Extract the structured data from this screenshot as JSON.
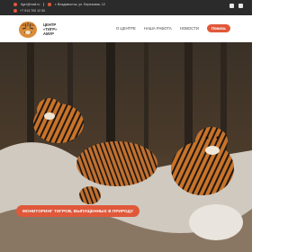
{
  "topbar": {
    "email": "tiger@mail.ru",
    "address": "г. Владивосток, ул. Березовая, 12",
    "phone": "+7 914 700 12 50",
    "social": [
      "vk-icon",
      "ok-icon"
    ]
  },
  "header": {
    "logo_text_line1": "ЦЕНТР",
    "logo_text_line2": "«ТИГР»",
    "logo_text_line3": "АМУР",
    "nav": [
      "О ЦЕНТРЕ",
      "НАША РАБОТА",
      "НОВОСТИ"
    ],
    "help_label": "Помочь"
  },
  "hero": {
    "cta_label": "МОНИТОРИНГ ТИГРОВ, ВЫПУЩЕННЫХ В ПРИРОДУ"
  },
  "colors": {
    "accent": "#e0583a",
    "topbar": "#2b2b2b"
  }
}
